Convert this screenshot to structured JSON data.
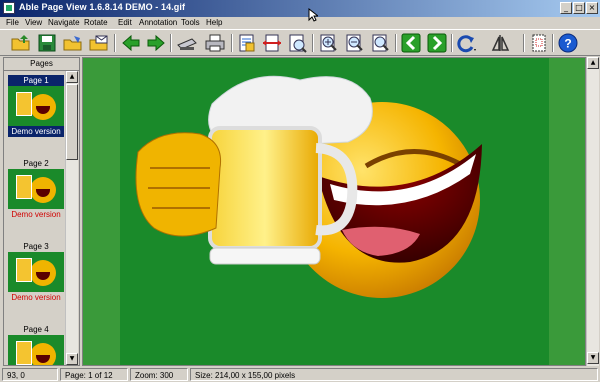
{
  "window": {
    "title": "Able Page View 1.6.8.14 DEMO  - 14.gif",
    "minimize": "_",
    "maximize": "□",
    "close": "×"
  },
  "menu": [
    "File",
    "View",
    "Navigate",
    "Rotate",
    "Edit",
    "Annotation",
    "Tools",
    "Help"
  ],
  "toolbar": [
    {
      "name": "open-folder-icon"
    },
    {
      "name": "save-icon"
    },
    {
      "name": "open-folder-2-icon"
    },
    {
      "name": "email-icon"
    },
    {
      "name": "previous-icon"
    },
    {
      "name": "next-icon"
    },
    {
      "name": "scanner-icon"
    },
    {
      "name": "print-icon"
    },
    {
      "name": "fit-page-icon"
    },
    {
      "name": "fit-width-icon"
    },
    {
      "name": "actual-size-icon"
    },
    {
      "name": "zoom-in-icon"
    },
    {
      "name": "zoom-out-icon"
    },
    {
      "name": "zoom-area-icon"
    },
    {
      "name": "page-back-icon"
    },
    {
      "name": "page-forward-icon"
    },
    {
      "name": "rotate-icon"
    },
    {
      "name": "flip-icon"
    },
    {
      "name": "select-area-icon"
    },
    {
      "name": "help-icon"
    }
  ],
  "pages_panel": {
    "header": "Pages",
    "thumbnails": [
      {
        "label": "Page 1",
        "demo": "Demo version",
        "selected": true
      },
      {
        "label": "Page 2",
        "demo": "Demo version",
        "selected": false
      },
      {
        "label": "Page 3",
        "demo": "Demo version",
        "selected": false
      },
      {
        "label": "Page 4",
        "demo": "",
        "selected": false
      }
    ]
  },
  "status": {
    "coords": "93, 0",
    "page": "Page: 1 of 12",
    "zoom": "Zoom: 300",
    "size": "Size: 214,00 x 155,00 pixels"
  },
  "colors": {
    "title_start": "#0a246a",
    "title_end": "#a6caf0",
    "viewer_bg": "#3a9a3a",
    "image_bg": "#1a8a2a",
    "demo_text": "#d00000"
  }
}
